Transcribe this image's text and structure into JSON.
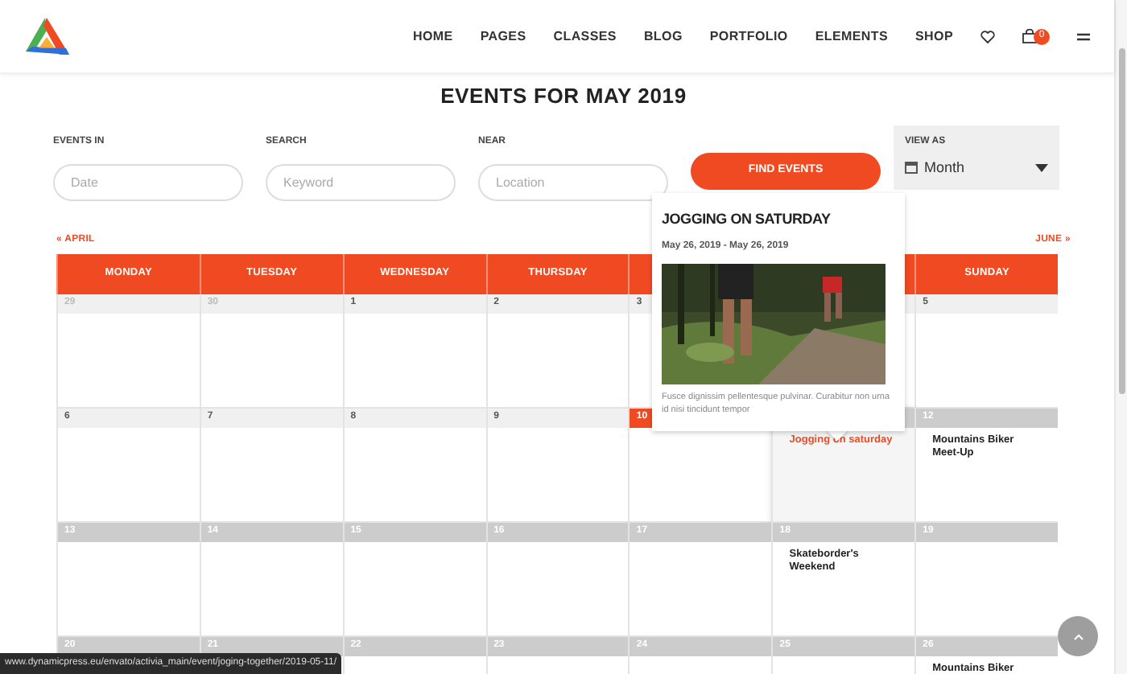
{
  "nav": {
    "items": [
      "HOME",
      "PAGES",
      "CLASSES",
      "BLOG",
      "PORTFOLIO",
      "ELEMENTS",
      "SHOP"
    ],
    "cart_count": "0"
  },
  "title": "EVENTS FOR MAY 2019",
  "filters": [
    {
      "label": "EVENTS IN",
      "placeholder": "Date"
    },
    {
      "label": "SEARCH",
      "placeholder": "Keyword"
    },
    {
      "label": "NEAR",
      "placeholder": "Location"
    }
  ],
  "find_button": "FIND EVENTS",
  "view_as": {
    "label": "VIEW AS",
    "value": "Month"
  },
  "prev_month": "« APRIL",
  "next_month": "JUNE »",
  "weekdays": [
    "MONDAY",
    "TUESDAY",
    "WEDNESDAY",
    "THURSDAY",
    "SUNDAY"
  ],
  "weeks": [
    [
      {
        "day": "29",
        "other_month": true,
        "past": true
      },
      {
        "day": "30",
        "other_month": true,
        "past": true
      },
      {
        "day": "1",
        "past": true
      },
      {
        "day": "2",
        "past": true
      },
      {
        "day": "3",
        "past": true
      },
      {
        "past": true
      },
      {
        "day": "5",
        "past": true
      }
    ],
    [
      {
        "day": "6",
        "past": true
      },
      {
        "day": "7",
        "past": true
      },
      {
        "day": "8",
        "past": true
      },
      {
        "day": "9",
        "past": true
      },
      {
        "day": "10",
        "today": true,
        "past": true
      },
      {
        "past": false,
        "hovered": true,
        "events": [
          {
            "title": "Jogging on saturday",
            "active": true
          }
        ]
      },
      {
        "day": "12",
        "past": false,
        "events": [
          {
            "title": "Mountains Biker Meet-Up",
            "active": false
          }
        ]
      }
    ],
    [
      {
        "day": "13",
        "past": false
      },
      {
        "day": "14",
        "past": false
      },
      {
        "day": "15",
        "past": false
      },
      {
        "day": "16",
        "past": false
      },
      {
        "day": "17",
        "past": false
      },
      {
        "day": "18",
        "past": false,
        "events": [
          {
            "title": "Skateborder's Weekend",
            "active": false
          }
        ]
      },
      {
        "day": "19",
        "past": false
      }
    ],
    [
      {
        "day": "20",
        "past": false
      },
      {
        "day": "21",
        "past": false
      },
      {
        "day": "22",
        "past": false
      },
      {
        "day": "23",
        "past": false
      },
      {
        "day": "24",
        "past": false
      },
      {
        "day": "25",
        "past": false
      },
      {
        "day": "26",
        "past": false,
        "events": [
          {
            "title": "Mountains Biker",
            "active": false
          }
        ]
      }
    ]
  ],
  "popup": {
    "title": "JOGGING ON SATURDAY",
    "dates": "May 26, 2019 - May 26, 2019",
    "description": "Fusce dignissim pellentesque pulvinar. Curabitur non urna id nisi tincidunt tempor"
  },
  "status_url": "www.dynamicpress.eu/envato/activia_main/event/joging-together/2019-05-11/"
}
